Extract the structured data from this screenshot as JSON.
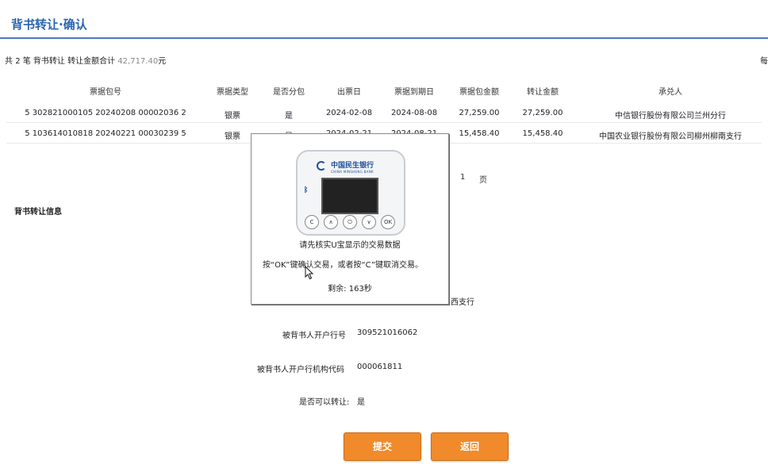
{
  "page": {
    "title": "背书转让·确认",
    "summary_prefix": "共",
    "summary_count": "2",
    "summary_mid": "笔 背书转让 转让金额合计",
    "summary_amount": "42,717.40",
    "summary_unit": "元",
    "per_page": "每"
  },
  "table": {
    "headers": [
      "票据包号",
      "票据类型",
      "是否分包",
      "出票日",
      "票据到期日",
      "票据包金额",
      "转让金额",
      "承兑人"
    ],
    "rows": [
      [
        "5 302821000105 20240208 00002036 2",
        "银票",
        "是",
        "2024-02-08",
        "2024-08-08",
        "27,259.00",
        "27,259.00",
        "中信银行股份有限公司兰州分行"
      ],
      [
        "5 103614010818 20240221 00030239 5",
        "银票",
        "是",
        "2024-02-21",
        "2024-08-21",
        "15,458.40",
        "15,458.40",
        "中国农业银行股份有限公司柳州柳南支行"
      ]
    ]
  },
  "pager": {
    "page_num": "1",
    "page_label": "页"
  },
  "section": {
    "title": "背书转让信息"
  },
  "form": {
    "bank_tail": "西支行",
    "open_bank_no_label": "被背书人开户行号",
    "open_bank_no_value": "309521016062",
    "org_code_label": "被背书人开户行机构代码",
    "org_code_value": "000061811",
    "transferable_label": "是否可以转让:",
    "transferable_value": "是"
  },
  "buttons": {
    "submit": "提交",
    "back": "返回"
  },
  "popup": {
    "bank_logo": "中国民生银行",
    "bank_logo_en": "CHINA MINSHENG BANK",
    "device_buttons": [
      "C",
      "∧",
      "⏻",
      "∨",
      "OK"
    ],
    "line1": "请先核实U宝显示的交易数据",
    "line2": "按“OK”键确认交易，或者按“C”键取消交易。",
    "line3": "剩余: 163秒"
  },
  "icons": {
    "bluetooth": "bluetooth-icon",
    "cursor": "mouse-cursor-icon"
  },
  "colors": {
    "title_blue": "#2a64b0",
    "button_orange": "#f08a2a"
  }
}
